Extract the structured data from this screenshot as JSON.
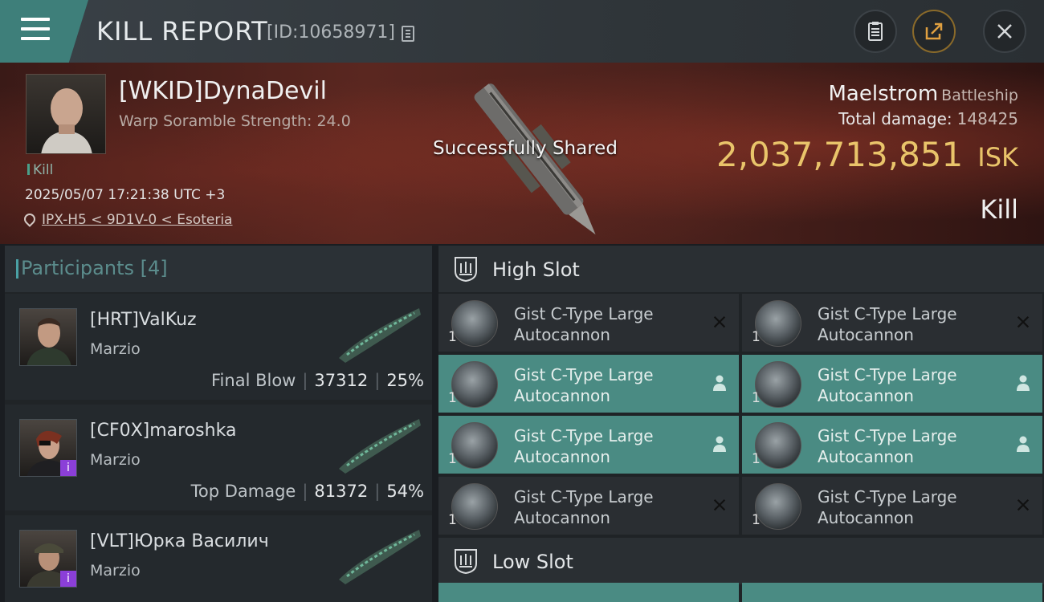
{
  "header": {
    "title": "KILL REPORT",
    "report_id": "[ID:10658971]"
  },
  "victim": {
    "name": "[WKID]DynaDevil",
    "detail": "Warp Soramble Strength: 24.0",
    "tag": "Kill",
    "datetime": "2025/05/07 17:21:38 UTC +3",
    "location": "IPX-H5 < 9D1V-0 < Esoteria"
  },
  "toast": "Successfully Shared",
  "summary": {
    "ship": "Maelstrom",
    "ship_class": "Battleship",
    "total_damage_label": "Total damage:",
    "total_damage_value": "148425",
    "isk_value": "2,037,713,851",
    "isk_unit": "ISK",
    "result": "Kill"
  },
  "participants": {
    "title": "Participants [4]",
    "items": [
      {
        "name": "[HRT]ValKuz",
        "ship": "Marzio",
        "stat_label": "Final Blow",
        "damage": "37312",
        "percent": "25%"
      },
      {
        "name": "[CF0X]maroshka",
        "ship": "Marzio",
        "stat_label": "Top Damage",
        "damage": "81372",
        "percent": "54%"
      },
      {
        "name": "[VLT]Юрка Василич",
        "ship": "Marzio"
      }
    ]
  },
  "fitting": {
    "high_slot_title": "High Slot",
    "low_slot_title": "Low Slot",
    "high_modules": [
      {
        "line1": "Gist C-Type Large",
        "line2": "Autocannon",
        "qty": "1",
        "state": "destroyed"
      },
      {
        "line1": "Gist C-Type Large",
        "line2": "Autocannon",
        "qty": "1",
        "state": "destroyed"
      },
      {
        "line1": "Gist C-Type Large",
        "line2": "Autocannon",
        "qty": "1",
        "state": "dropped"
      },
      {
        "line1": "Gist C-Type Large",
        "line2": "Autocannon",
        "qty": "1",
        "state": "dropped"
      },
      {
        "line1": "Gist C-Type Large",
        "line2": "Autocannon",
        "qty": "1",
        "state": "dropped"
      },
      {
        "line1": "Gist C-Type Large",
        "line2": "Autocannon",
        "qty": "1",
        "state": "dropped"
      },
      {
        "line1": "Gist C-Type Large",
        "line2": "Autocannon",
        "qty": "1",
        "state": "destroyed"
      },
      {
        "line1": "Gist C-Type Large",
        "line2": "Autocannon",
        "qty": "1",
        "state": "destroyed"
      }
    ]
  },
  "colors": {
    "accent": "#4a8b83",
    "isk_gold": "#e9c46a",
    "menu_tab": "#3e7f7a"
  },
  "icons": {
    "menu": "menu-icon",
    "copy": "copy-icon",
    "clipboard": "clipboard-icon",
    "share": "share-icon",
    "close": "close-icon",
    "location": "location-pin-icon",
    "slot": "slot-shield-icon",
    "module": "autocannon-icon",
    "destroyed": "x-icon",
    "dropped": "user-icon"
  }
}
